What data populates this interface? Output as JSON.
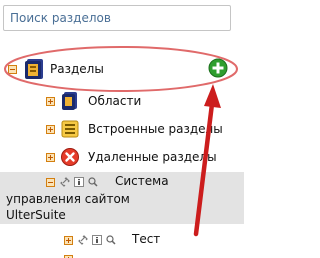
{
  "search": {
    "placeholder": "Поиск разделов",
    "value": ""
  },
  "tree": {
    "root": {
      "label": "Разделы",
      "expanded": true,
      "icon": "sections-book-icon",
      "add_icon": "add-green-icon"
    },
    "children": [
      {
        "label": "Области",
        "expanded": false,
        "icon": "areas-icon"
      },
      {
        "label": "Встроенные разделы",
        "expanded": false,
        "icon": "builtin-list-icon"
      },
      {
        "label": "Удаленные разделы",
        "expanded": false,
        "icon": "deleted-red-icon"
      },
      {
        "label_lines": [
          "Система",
          "управления сайтом",
          "UlterSuite"
        ],
        "expanded": true,
        "selected": true,
        "icons": [
          "link-icon",
          "info-icon",
          "search-icon"
        ]
      },
      {
        "label": "Тест",
        "expanded": false,
        "icons": [
          "link-icon",
          "info-icon",
          "search-icon"
        ]
      }
    ]
  },
  "annotations": {
    "highlight_color": "#e06a6a",
    "arrow_color": "#cc1d1d"
  },
  "colors": {
    "selected_row": "#e3e3e3",
    "expander_border": "#d37f10",
    "expander_fill": "#fbe3b6",
    "add_button": "#2e9e2e"
  }
}
